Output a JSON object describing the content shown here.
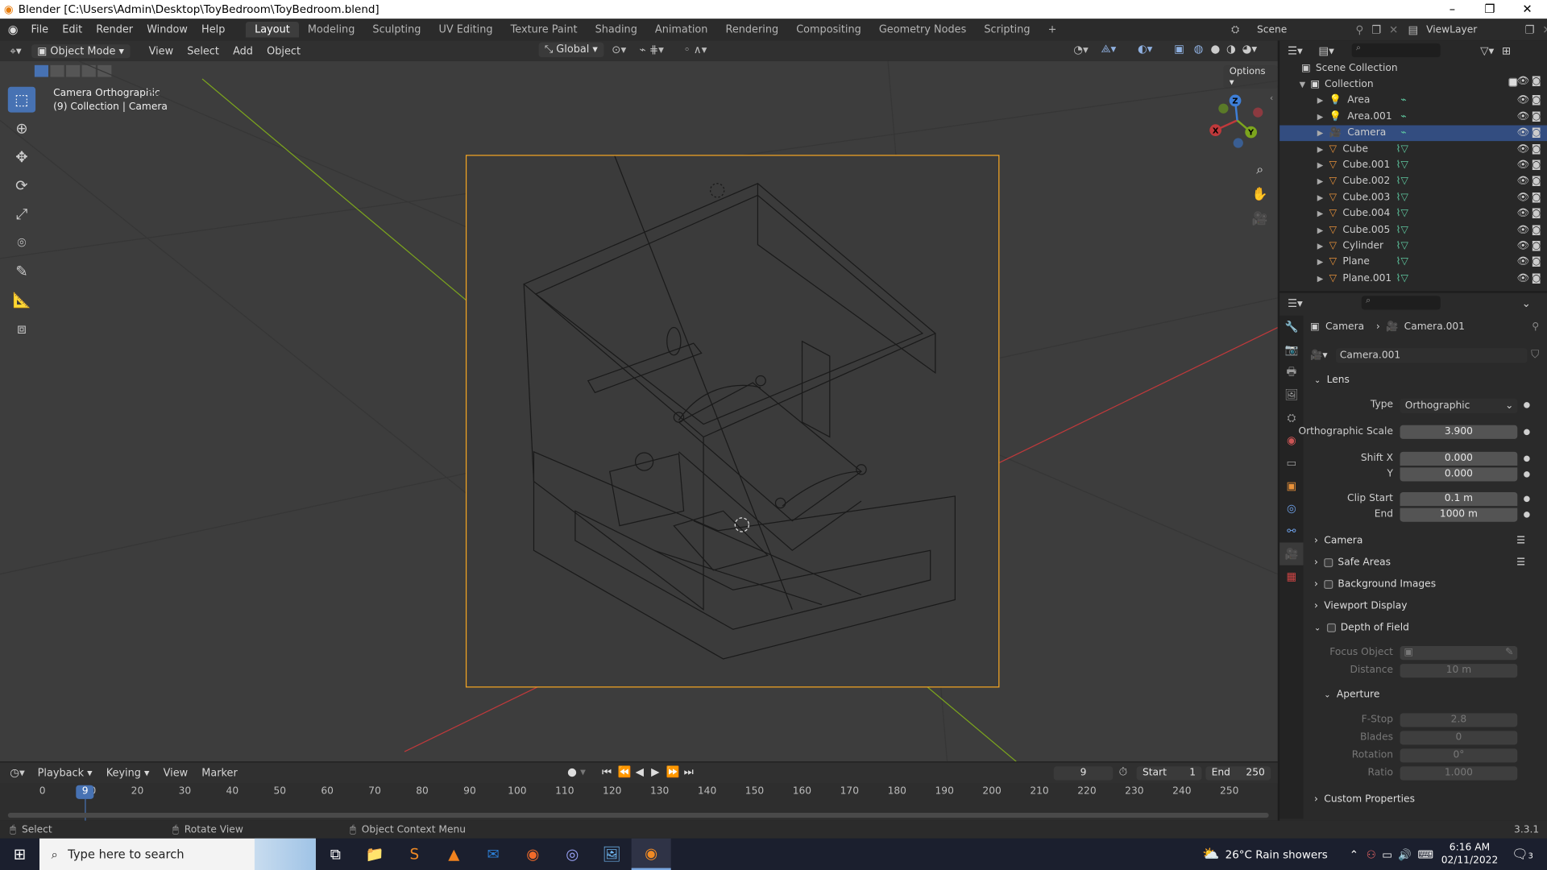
{
  "window": {
    "title": "Blender [C:\\Users\\Admin\\Desktop\\ToyBedroom\\ToyBedroom.blend]",
    "min": "–",
    "max": "❐",
    "close": "✕"
  },
  "menu": {
    "items": [
      "File",
      "Edit",
      "Render",
      "Window",
      "Help"
    ],
    "workspaces": [
      "Layout",
      "Modeling",
      "Sculpting",
      "UV Editing",
      "Texture Paint",
      "Shading",
      "Animation",
      "Rendering",
      "Compositing",
      "Geometry Nodes",
      "Scripting"
    ],
    "add_ws": "+",
    "scene": "Scene",
    "viewlayer": "ViewLayer"
  },
  "header3d": {
    "mode": "Object Mode",
    "menus": [
      "View",
      "Select",
      "Add",
      "Object"
    ],
    "orientation": "Global",
    "options": "Options"
  },
  "viewport": {
    "camera_line1": "Camera Orthographic",
    "camera_line2": "(9) Collection | Camera",
    "gizmo": {
      "x": "X",
      "y": "Y",
      "z": "Z"
    },
    "colors": {
      "selected": "#f5a623",
      "x_axis": "#c0393b",
      "y_axis": "#7ca51d"
    }
  },
  "outliner": {
    "scene_collection": "Scene Collection",
    "collection": "Collection",
    "items": [
      {
        "name": "Area",
        "type": "light"
      },
      {
        "name": "Area.001",
        "type": "light"
      },
      {
        "name": "Camera",
        "type": "camera",
        "selected": true
      },
      {
        "name": "Cube",
        "type": "mesh"
      },
      {
        "name": "Cube.001",
        "type": "mesh"
      },
      {
        "name": "Cube.002",
        "type": "mesh"
      },
      {
        "name": "Cube.003",
        "type": "mesh"
      },
      {
        "name": "Cube.004",
        "type": "mesh"
      },
      {
        "name": "Cube.005",
        "type": "mesh"
      },
      {
        "name": "Cylinder",
        "type": "mesh"
      },
      {
        "name": "Plane",
        "type": "mesh"
      },
      {
        "name": "Plane.001",
        "type": "mesh"
      }
    ]
  },
  "properties": {
    "breadcrumb_object": "Camera",
    "breadcrumb_data": "Camera.001",
    "datablock": "Camera.001",
    "lens_title": "Lens",
    "type_label": "Type",
    "type_value": "Orthographic",
    "ortho_label": "Orthographic Scale",
    "ortho_value": "3.900",
    "shiftx_label": "Shift X",
    "shiftx_value": "0.000",
    "shifty_label": "Y",
    "shifty_value": "0.000",
    "clipstart_label": "Clip Start",
    "clipstart_value": "0.1 m",
    "clipend_label": "End",
    "clipend_value": "1000 m",
    "camera_title": "Camera",
    "safe_areas": "Safe Areas",
    "background_images": "Background Images",
    "viewport_display": "Viewport Display",
    "dof": "Depth of Field",
    "focus_label": "Focus Object",
    "distance_label": "Distance",
    "distance_value": "10 m",
    "aperture": "Aperture",
    "fstop_label": "F-Stop",
    "fstop_value": "2.8",
    "blades_label": "Blades",
    "blades_value": "0",
    "rotation_label": "Rotation",
    "rotation_value": "0°",
    "ratio_label": "Ratio",
    "ratio_value": "1.000",
    "custom": "Custom Properties"
  },
  "timeline": {
    "menus": [
      "Playback",
      "Keying",
      "View",
      "Marker"
    ],
    "current_frame": "9",
    "start_label": "Start",
    "start": "1",
    "end_label": "End",
    "end": "250",
    "ticks": [
      "0",
      "10",
      "20",
      "30",
      "40",
      "50",
      "60",
      "70",
      "80",
      "90",
      "100",
      "110",
      "120",
      "130",
      "140",
      "150",
      "160",
      "170",
      "180",
      "190",
      "200",
      "210",
      "220",
      "230",
      "240",
      "250"
    ],
    "playhead": 9
  },
  "statusbar": {
    "select": "Select",
    "rotate": "Rotate View",
    "context": "Object Context Menu",
    "version": "3.3.1"
  },
  "taskbar": {
    "search_placeholder": "Type here to search",
    "weather": "26°C  Rain showers",
    "time": "6:16 AM",
    "date": "02/11/2022",
    "notif": "3"
  }
}
